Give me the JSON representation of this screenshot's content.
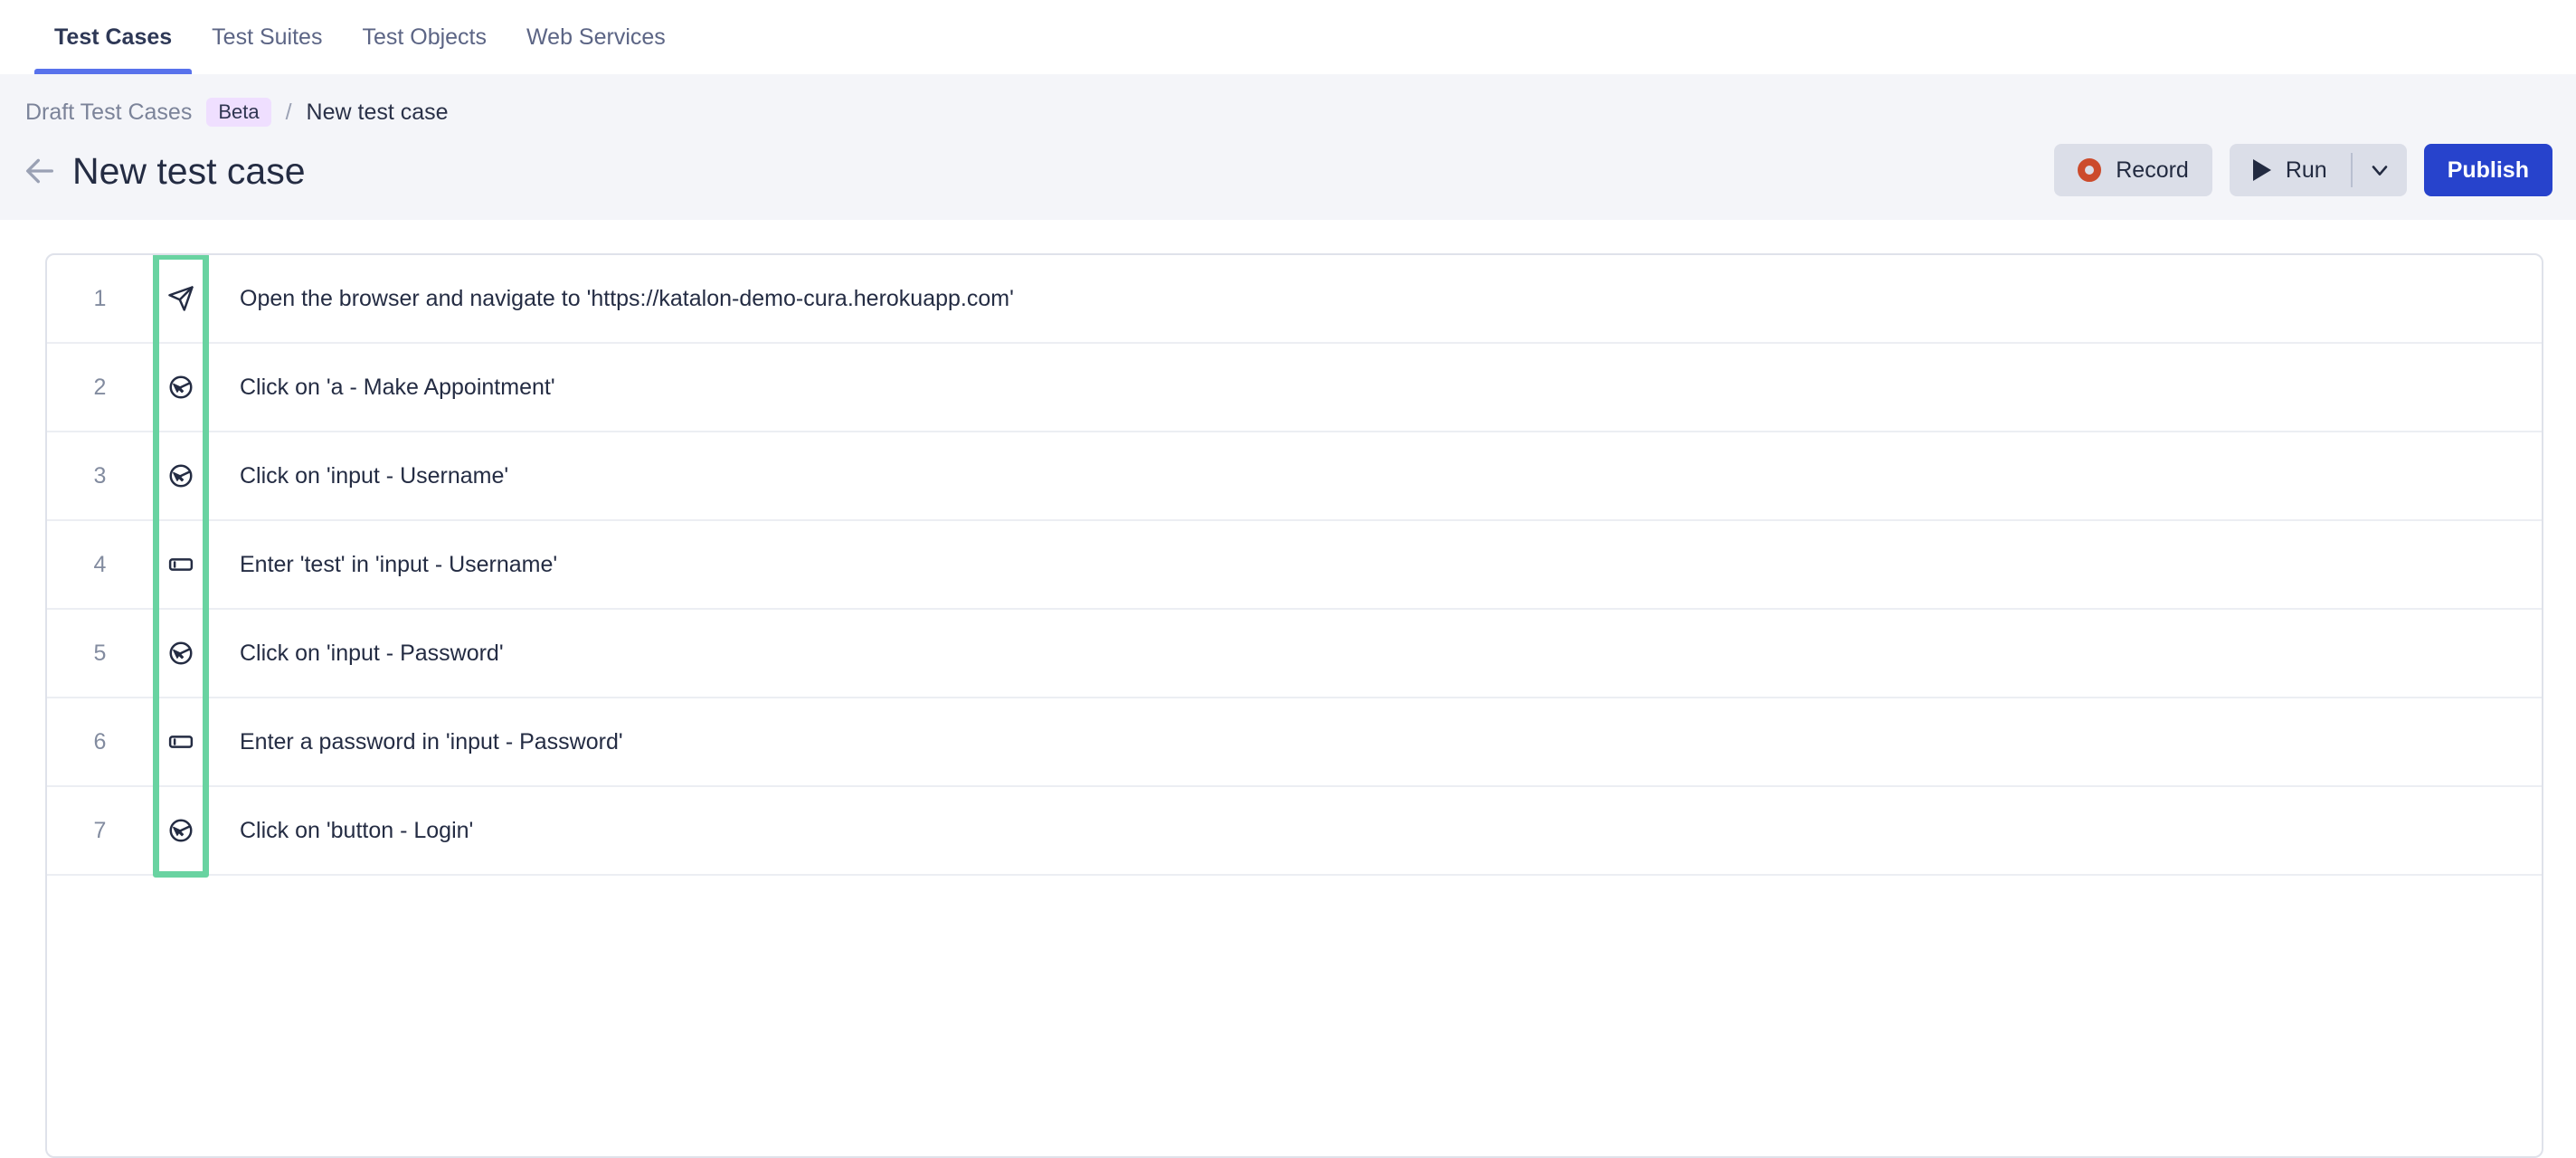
{
  "tabs": [
    {
      "label": "Test Cases",
      "active": true
    },
    {
      "label": "Test Suites",
      "active": false
    },
    {
      "label": "Test Objects",
      "active": false
    },
    {
      "label": "Web Services",
      "active": false
    }
  ],
  "breadcrumb": {
    "root": "Draft Test Cases",
    "badge": "Beta",
    "separator": "/",
    "current": "New test case"
  },
  "header": {
    "title": "New test case",
    "back_icon": "arrow-left-icon"
  },
  "toolbar": {
    "record_label": "Record",
    "record_icon": "record-dot-icon",
    "run_label": "Run",
    "run_icon": "play-icon",
    "run_caret_icon": "chevron-down-icon",
    "publish_label": "Publish"
  },
  "colors": {
    "accent_blue": "#5872ec",
    "primary_blue": "#2743cc",
    "record_orange": "#cc4b2c",
    "highlight_green": "#69d3a1",
    "beta_badge_bg": "#efdfff",
    "page_bg": "#f4f5f9",
    "button_grey": "#dbdee8"
  },
  "steps": [
    {
      "num": "1",
      "icon": "navigate-icon",
      "text": "Open the browser and navigate to 'https://katalon-demo-cura.herokuapp.com'"
    },
    {
      "num": "2",
      "icon": "click-icon",
      "text": "Click on 'a - Make Appointment'"
    },
    {
      "num": "3",
      "icon": "click-icon",
      "text": "Click on 'input - Username'"
    },
    {
      "num": "4",
      "icon": "text-input-icon",
      "text": "Enter 'test' in 'input - Username'"
    },
    {
      "num": "5",
      "icon": "click-icon",
      "text": "Click on 'input - Password'"
    },
    {
      "num": "6",
      "icon": "text-input-icon",
      "text": "Enter a password in 'input - Password'"
    },
    {
      "num": "7",
      "icon": "click-icon",
      "text": "Click on 'button - Login'"
    }
  ]
}
